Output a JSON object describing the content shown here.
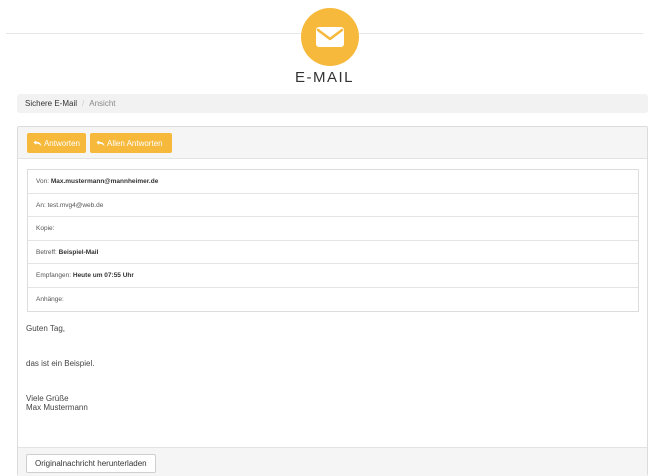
{
  "header": {
    "title": "E-MAIL",
    "logo_icon": "envelope-icon",
    "accent_color": "#f6b93b"
  },
  "breadcrumb": {
    "items": [
      "Sichere E-Mail",
      "Ansicht"
    ],
    "separator": "/"
  },
  "toolbar": {
    "reply_label": "Antworten",
    "reply_all_label": "Allen Antworten",
    "reply_icon": "reply-icon"
  },
  "email_headers": [
    {
      "label": "Von:",
      "value": "Max.mustermann@mannheimer.de"
    },
    {
      "label": "An:",
      "value": "test.mvg4@web.de"
    },
    {
      "label": "Kopie:",
      "value": ""
    },
    {
      "label": "Betreff:",
      "value": "Beispiel-Mail"
    },
    {
      "label": "Empfangen:",
      "value": "Heute um 07:55 Uhr"
    },
    {
      "label": "Anhänge:",
      "value": ""
    }
  ],
  "body": {
    "greeting": "Guten Tag,",
    "text": "das ist ein Beispiel.",
    "closing": "Viele Grüße",
    "signature": "Max Mustermann"
  },
  "footer": {
    "download_label": "Originalnachricht herunterladen"
  }
}
